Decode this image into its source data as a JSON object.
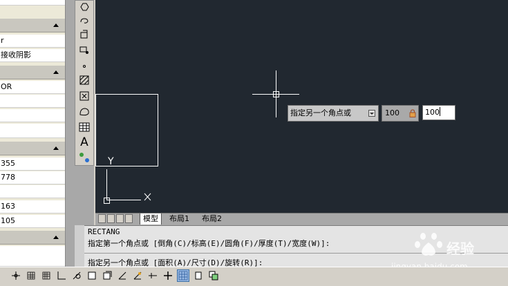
{
  "properties": {
    "rows": [
      {
        "text": "r"
      },
      {
        "text": "接收阴影"
      },
      {
        "text": "OR"
      },
      {
        "text": "355"
      },
      {
        "text": "778"
      },
      {
        "text": "163"
      },
      {
        "text": "105"
      }
    ]
  },
  "dynamic_input": {
    "prompt": "指定另一个角点或",
    "value1": "100",
    "value2": "100"
  },
  "canvas": {
    "ucs_y_label": "Y",
    "background": "#212830"
  },
  "layout_tabs": [
    "模型",
    "布局1",
    "布局2"
  ],
  "command_line": {
    "line1": "RECTANG",
    "line2": "指定第一个角点或 [倒角(C)/标高(E)/圆角(F)/厚度(T)/宽度(W)]:",
    "line3": "指定另一个角点或 [面积(A)/尺寸(D)/旋转(R)]:"
  },
  "watermark": {
    "brand": "经验",
    "url": "jingyan.baidu.com"
  },
  "toolbar_icons": [
    "polygon-icon",
    "revcloud-icon",
    "insert-block-icon",
    "make-block-icon",
    "point-icon",
    "hatch-icon",
    "gradient-icon",
    "region-icon",
    "table-icon",
    "mtext-icon",
    "add-selected-icon"
  ],
  "status_icons": [
    "snap-icon",
    "grid-icon",
    "ortho-icon",
    "polar-icon",
    "osnap-icon",
    "otrack-icon",
    "ducs-icon",
    "dyn-icon",
    "lwt-icon",
    "qp-icon",
    "sc-icon",
    "model-icon"
  ]
}
